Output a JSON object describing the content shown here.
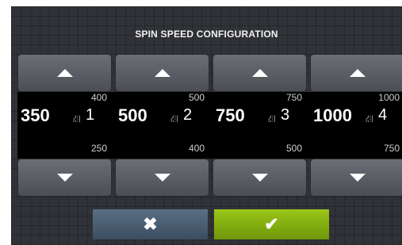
{
  "title": "SPIN SPEED CONFIGURATION",
  "icons": {
    "up_arrow": "triangle-up",
    "down_arrow": "triangle-down",
    "program": "spin-program-icon",
    "cancel": "x-icon",
    "confirm": "check-icon"
  },
  "colors": {
    "panel": "#303237",
    "strip": "#000000",
    "cancel": "#4a5e72",
    "confirm": "#8bb312"
  },
  "programs": [
    {
      "current": "350",
      "program": "1",
      "max": "400",
      "min": "250"
    },
    {
      "current": "500",
      "program": "2",
      "max": "500",
      "min": "400"
    },
    {
      "current": "750",
      "program": "3",
      "max": "750",
      "min": "500"
    },
    {
      "current": "1000",
      "program": "4",
      "max": "1000",
      "min": "750"
    }
  ],
  "glyphs": {
    "program_icon": "⛜",
    "cancel": "✖",
    "confirm": "✔"
  }
}
